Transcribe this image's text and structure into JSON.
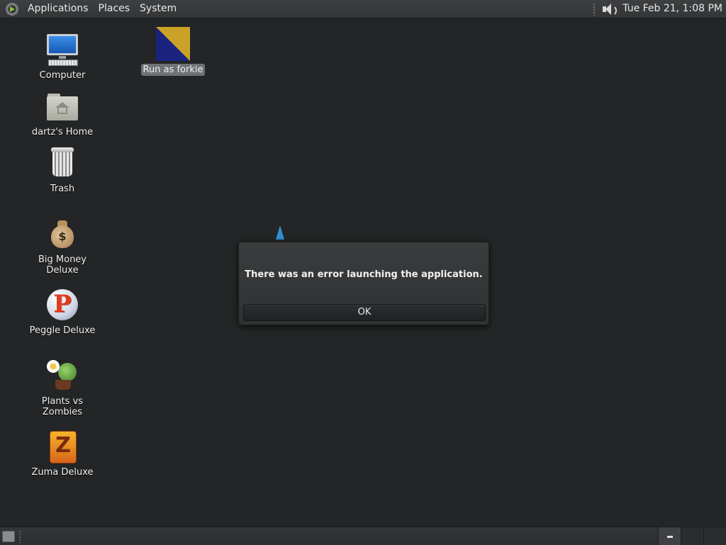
{
  "top_panel": {
    "menus": [
      "Applications",
      "Places",
      "System"
    ],
    "clock": "Tue Feb 21,  1:08 PM"
  },
  "desktop": {
    "icons": [
      {
        "label": "Computer",
        "icon": "computer-icon"
      },
      {
        "label": "dartz's Home",
        "icon": "home-folder-icon"
      },
      {
        "label": "Trash",
        "icon": "trash-icon"
      },
      {
        "label": "Big Money Deluxe",
        "icon": "money-bag-icon"
      },
      {
        "label": "Peggle Deluxe",
        "icon": "peggle-icon"
      },
      {
        "label": "Plants vs Zombies",
        "icon": "plants-vs-zombies-icon"
      },
      {
        "label": "Zuma Deluxe",
        "icon": "zuma-icon"
      }
    ],
    "launcher": {
      "label": "Run as forkie",
      "icon": "launcher-icon",
      "selected": true
    }
  },
  "dialog": {
    "message": "There was an error launching the application.",
    "ok_label": "OK"
  },
  "bottom_panel": {
    "workspaces": 3,
    "active_workspace": 1
  }
}
